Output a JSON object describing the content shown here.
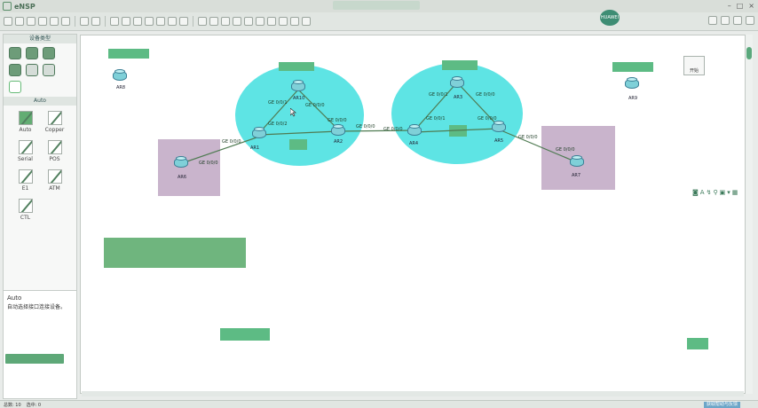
{
  "app": {
    "title": "eNSP"
  },
  "titlebar": {
    "pill_items": [
      "",
      "",
      "",
      ""
    ]
  },
  "badge": {
    "label": "HUAWEI"
  },
  "left_panel": {
    "header": "设备类型",
    "section_header": "Auto",
    "devices": [
      {
        "label": "Auto",
        "icon": "lightning-cable-icon"
      },
      {
        "label": "Copper",
        "icon": "copper-cable-icon"
      },
      {
        "label": "Serial",
        "icon": "serial-cable-icon"
      },
      {
        "label": "POS",
        "icon": "pos-cable-icon"
      },
      {
        "label": "E1",
        "icon": "e1-cable-icon"
      },
      {
        "label": "ATM",
        "icon": "atm-cable-icon"
      },
      {
        "label": "CTL",
        "icon": "ctl-cable-icon"
      }
    ],
    "description_title": "Auto",
    "description_text": "自动选择接口连接设备。"
  },
  "canvas": {
    "routers": [
      {
        "label": "AR1"
      },
      {
        "label": "AR2"
      },
      {
        "label": "AR3"
      },
      {
        "label": "AR4"
      },
      {
        "label": "AR5"
      },
      {
        "label": "AR6"
      },
      {
        "label": "AR7"
      },
      {
        "label": "AR8"
      },
      {
        "label": "AR9"
      },
      {
        "label": "AR10"
      }
    ],
    "port_labels": [
      "GE 0/0/0",
      "GE 0/0/1",
      "GE 0/0/2"
    ],
    "note_button": "开始"
  },
  "statusbar": {
    "total": "总数: 10",
    "selected": "选中: 0",
    "right": "获取帮助与反馈"
  },
  "colors": {
    "zone": "#5ee4e4",
    "area": "#c9b4cc",
    "accent": "#5dbb84"
  }
}
